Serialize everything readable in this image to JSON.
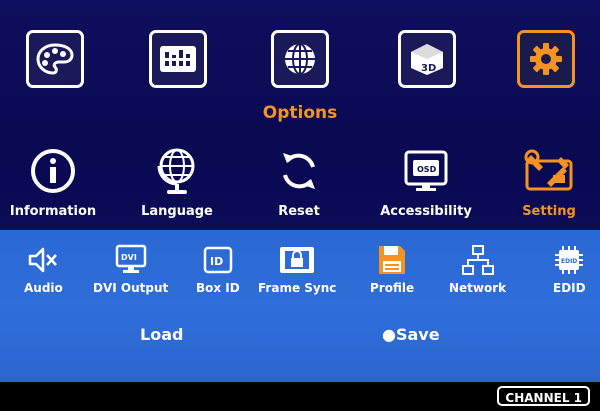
{
  "menu": {
    "top_icons": [
      {
        "name": "palette-icon"
      },
      {
        "name": "equalizer-icon"
      },
      {
        "name": "globe-icon"
      },
      {
        "name": "3d-cube-icon"
      },
      {
        "name": "gear-icon",
        "selected": true
      }
    ],
    "section_title": "Options"
  },
  "options": {
    "items": [
      {
        "label": "Information",
        "icon": "info-icon"
      },
      {
        "label": "Language",
        "icon": "globe-icon"
      },
      {
        "label": "Reset",
        "icon": "refresh-icon"
      },
      {
        "label": "Accessibility",
        "icon": "osd-icon"
      },
      {
        "label": "Setting",
        "icon": "tools-icon",
        "selected": true
      }
    ]
  },
  "settings": {
    "items": [
      {
        "label": "Audio",
        "icon": "speaker-mute-icon"
      },
      {
        "label": "DVI Output",
        "icon": "dvi-icon"
      },
      {
        "label": "Box ID",
        "icon": "id-icon"
      },
      {
        "label": "Frame Sync",
        "icon": "lock-icon"
      },
      {
        "label": "Profile",
        "icon": "save-disk-icon",
        "selected": true
      },
      {
        "label": "Network",
        "icon": "network-icon"
      },
      {
        "label": "EDID",
        "icon": "edid-chip-icon"
      }
    ],
    "profile_actions": {
      "load_label": "Load",
      "save_label": "●Save"
    }
  },
  "status": {
    "channel": "CHANNEL 1"
  },
  "colors": {
    "top_background": "#0b0b55",
    "bottom_background": "#2d6bd6",
    "accent": "#f39323",
    "text": "#ffffff"
  }
}
